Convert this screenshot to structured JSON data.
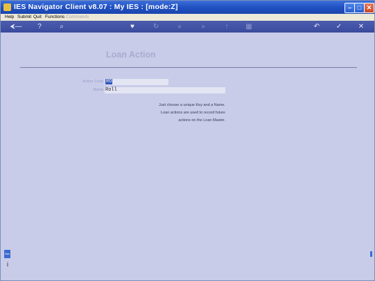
{
  "window": {
    "title": "IES Navigator Client v8.07 : My IES :        [mode:Z]",
    "minimize": "–",
    "maximize": "□",
    "close": "✕"
  },
  "menu": {
    "help": "Help",
    "submit": "Submit",
    "quit": "Quit",
    "functions": "Functions",
    "commands": "Commands"
  },
  "toolbar": {
    "key": "⮜—",
    "help": "?",
    "search": "⌕",
    "heart": "♥",
    "refresh": "↻",
    "back": "«",
    "forward": "»",
    "up": "↑",
    "grid": "▦",
    "undo": "↶",
    "ok": "✓",
    "cancel": "✕"
  },
  "form": {
    "title": "Loan Action",
    "action_code_label": "Action Code",
    "action_code_value": "RO",
    "name_label": "Name",
    "name_value": "Roll",
    "note_lines": [
      "Just choose a unique Key and a Name.",
      "Loan actions are used to record future",
      "actions on the Loan Master."
    ]
  },
  "side": {
    "tab": "Nav",
    "icon": "i"
  }
}
